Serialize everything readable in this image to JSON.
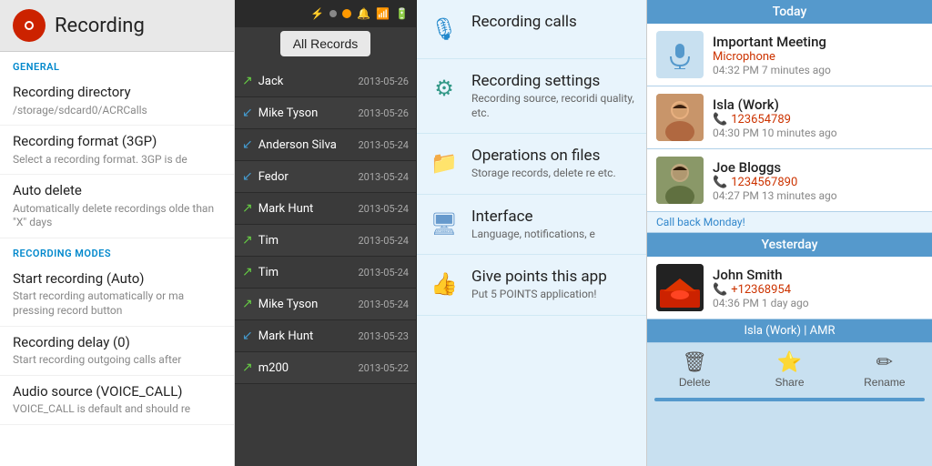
{
  "settings": {
    "header": {
      "title": "Recording",
      "icon": "●"
    },
    "sections": [
      {
        "label": "GENERAL",
        "items": [
          {
            "title": "Recording directory",
            "desc": "/storage/sdcard0/ACRCalls"
          },
          {
            "title": "Recording format (3GP)",
            "desc": "Select a recording format. 3GP is de"
          },
          {
            "title": "Auto delete",
            "desc": "Automatically delete recordings olde than \"X\" days"
          }
        ]
      },
      {
        "label": "RECORDING MODES",
        "items": [
          {
            "title": "Start recording (Auto)",
            "desc": "Start recording automatically or ma pressing record button"
          },
          {
            "title": "Recording delay (0)",
            "desc": "Start recording outgoing calls after"
          },
          {
            "title": "Audio source (VOICE_CALL)",
            "desc": "VOICE_CALL is default and should re"
          }
        ]
      }
    ]
  },
  "records": {
    "btn_label": "All Records",
    "items": [
      {
        "name": "Jack",
        "date": "2013-05-26",
        "type": "out"
      },
      {
        "name": "Mike Tyson",
        "date": "2013-05-26",
        "type": "in"
      },
      {
        "name": "Anderson Silva",
        "date": "2013-05-24",
        "type": "in"
      },
      {
        "name": "Fedor",
        "date": "2013-05-24",
        "type": "in"
      },
      {
        "name": "Mark Hunt",
        "date": "2013-05-24",
        "type": "out"
      },
      {
        "name": "Tim",
        "date": "2013-05-24",
        "type": "out"
      },
      {
        "name": "Tim",
        "date": "2013-05-24",
        "type": "out"
      },
      {
        "name": "Mike Tyson",
        "date": "2013-05-24",
        "type": "out"
      },
      {
        "name": "Mark Hunt",
        "date": "2013-05-23",
        "type": "in"
      },
      {
        "name": "m200",
        "date": "2013-05-22",
        "type": "out"
      }
    ]
  },
  "menu": {
    "items": [
      {
        "icon": "🎙",
        "icon_class": "menu-icon-blue",
        "title": "Recording calls",
        "desc": ""
      },
      {
        "icon": "⚙",
        "icon_class": "menu-icon-teal",
        "title": "Recording settings",
        "desc": "Recording source, recoridi quality, etc."
      },
      {
        "icon": "📁",
        "icon_class": "menu-icon-folder",
        "title": "Operations on files",
        "desc": "Storage records, delete re etc."
      },
      {
        "icon": "🖥",
        "icon_class": "menu-icon-screen",
        "title": "Interface",
        "desc": "Language, notifications, e"
      },
      {
        "icon": "👍",
        "icon_class": "menu-icon-orange",
        "title": "Give points this app",
        "desc": "Put 5 POINTS application!"
      }
    ]
  },
  "calllog": {
    "today_label": "Today",
    "yesterday_label": "Yesterday",
    "bottom_bar_label": "Isla (Work) | AMR",
    "items_today": [
      {
        "id": "important-meeting",
        "name": "Important Meeting",
        "sub": "Microphone",
        "time": "04:32 PM",
        "ago": "7 minutes ago",
        "avatar_type": "mic"
      },
      {
        "id": "isla-work",
        "name": "Isla (Work)",
        "number": "123654789",
        "time": "04:30 PM",
        "ago": "10 minutes ago",
        "avatar_type": "person1"
      },
      {
        "id": "joe-bloggs",
        "name": "Joe Bloggs",
        "number": "1234567890",
        "time": "04:27 PM",
        "ago": "13 minutes ago",
        "avatar_type": "person2",
        "note": "Call back Monday!"
      }
    ],
    "items_yesterday": [
      {
        "id": "john-smith",
        "name": "John Smith",
        "number": "+12368954",
        "time": "04:36 PM",
        "ago": "1 day ago",
        "avatar_type": "car"
      }
    ],
    "actions": [
      {
        "icon": "✕",
        "label": "Delete"
      },
      {
        "icon": "★",
        "label": "Share"
      },
      {
        "icon": "✎",
        "label": "Rename"
      }
    ]
  },
  "icons": {
    "arrow_out": "↗",
    "arrow_in": "↙",
    "phone": "📞"
  }
}
